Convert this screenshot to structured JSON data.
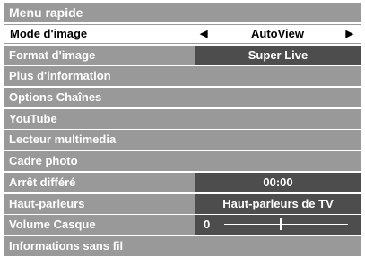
{
  "menu": {
    "title": "Menu rapide",
    "items": [
      {
        "label": "Mode d'image",
        "value": "AutoView"
      },
      {
        "label": "Format d'image",
        "value": "Super Live"
      },
      {
        "label": "Plus d'information"
      },
      {
        "label": "Options Chaînes"
      },
      {
        "label": "YouTube"
      },
      {
        "label": "Lecteur multimedia"
      },
      {
        "label": "Cadre photo"
      },
      {
        "label": "Arrêt différé",
        "value": "00:00"
      },
      {
        "label": "Haut-parleurs",
        "value": "Haut-parleurs de TV"
      },
      {
        "label": "Volume Casque",
        "value": "0",
        "level_fraction": 0.45
      },
      {
        "label": "Informations sans fil"
      }
    ]
  },
  "icons": {
    "left_arrow": "triangle-left-icon",
    "right_arrow": "triangle-right-icon"
  },
  "colors": {
    "row_bg": "#999999",
    "value_bg": "#4d4d4d",
    "selected_bg": "#ffffff",
    "text": "#ffffff"
  }
}
